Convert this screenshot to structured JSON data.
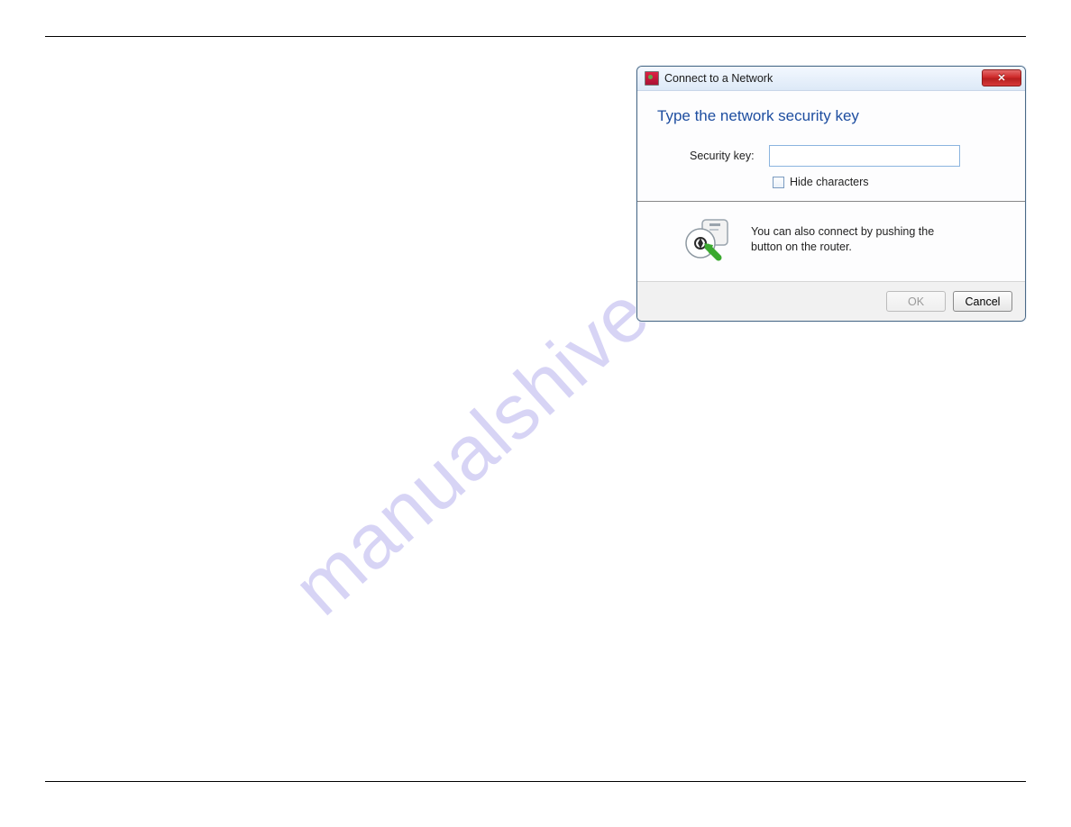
{
  "watermark": "manualshive.com",
  "dialog": {
    "title": "Connect to a Network",
    "heading": "Type the network security key",
    "field_label": "Security key:",
    "field_value": "",
    "hide_label": "Hide characters",
    "hint_line1": "You can also connect by pushing the",
    "hint_line2": "button on the router.",
    "ok_label": "OK",
    "cancel_label": "Cancel",
    "close_glyph": "✕"
  }
}
